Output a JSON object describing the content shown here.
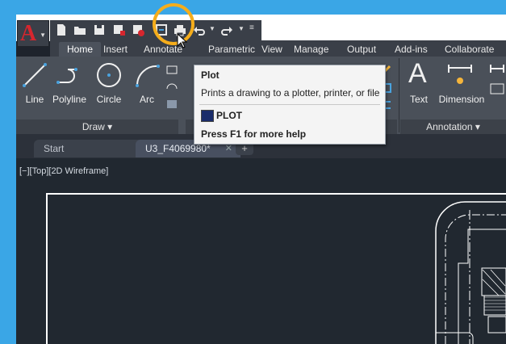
{
  "ribbon_tabs": [
    "Home",
    "Insert",
    "Annotate",
    "Parametric",
    "View",
    "Manage",
    "Output",
    "Add-ins",
    "Collaborate"
  ],
  "draw_tools": [
    "Line",
    "Polyline",
    "Circle",
    "Arc"
  ],
  "annotation_tools": [
    "Text",
    "Dimension"
  ],
  "panels": {
    "draw": "Draw ▾",
    "annotation": "Annotation ▾"
  },
  "file_tabs": {
    "start": "Start",
    "current": "U3_F4069980*",
    "close_glyph": "✕",
    "add_glyph": "+"
  },
  "viewport_label": "[−][Top][2D Wireframe]",
  "tooltip": {
    "title": "Plot",
    "description": "Prints a drawing to a plotter, printer, or file",
    "command": "PLOT",
    "help": "Press F1 for more help"
  },
  "app_logo": "A",
  "colors": {
    "accent": "#f5ad1b",
    "brand": "#d6262e"
  }
}
